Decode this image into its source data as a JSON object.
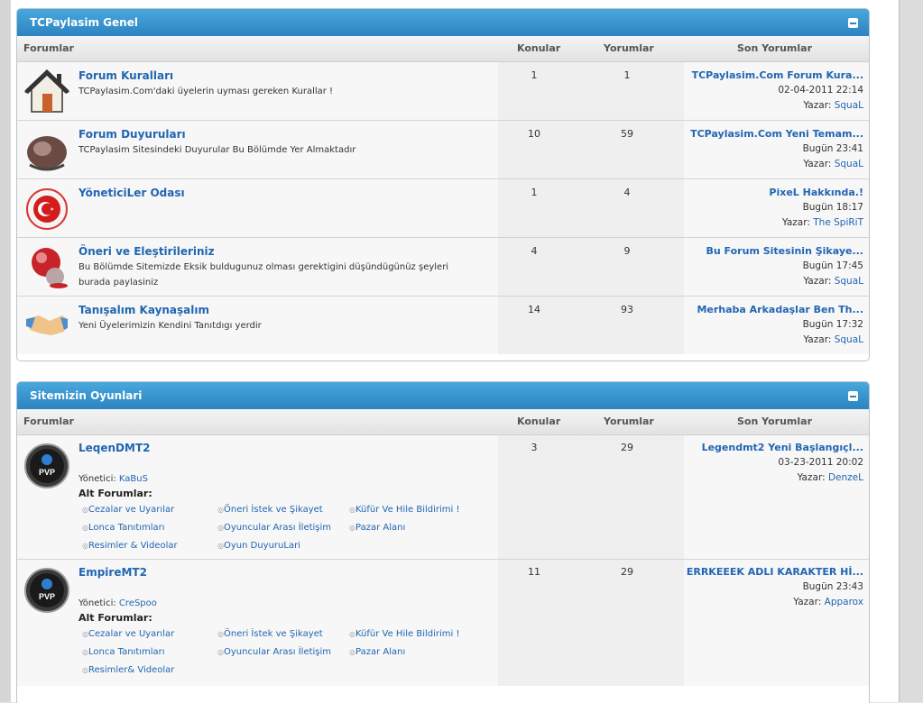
{
  "categories": [
    {
      "title": "TCPaylasim Genel",
      "columns": {
        "forums": "Forumlar",
        "topics": "Konular",
        "posts": "Yorumlar",
        "last": "Son Yorumlar"
      },
      "forums": [
        {
          "icon": "house-icon",
          "title": "Forum Kuralları",
          "desc": "TCPaylasim.Com'daki üyelerin uyması gereken Kurallar !",
          "topics": "1",
          "posts": "1",
          "last_title": "TCPaylasim.Com Forum Kura...",
          "last_date": "02-04-2011 22:14",
          "by_label": "Yazar:",
          "last_user": "SquaL"
        },
        {
          "icon": "megaphone-icon",
          "title": "Forum Duyuruları",
          "desc": "TCPaylasim Sitesindeki Duyurular Bu Bölümde Yer Almaktadır",
          "topics": "10",
          "posts": "59",
          "last_title": "TCPaylasim.Com Yeni Temam...",
          "last_date": "Bugün 23:41",
          "by_label": "Yazar:",
          "last_user": "SquaL"
        },
        {
          "icon": "turkish-flag-icon",
          "title": "YöneticiLer Odası",
          "desc": "",
          "topics": "1",
          "posts": "4",
          "last_title": "PixeL Hakkında.!",
          "last_date": "Bugün 18:17",
          "by_label": "Yazar:",
          "last_user": "The SpiRiT"
        },
        {
          "icon": "speech-bubble-icon",
          "title": "Öneri ve Eleştirileriniz",
          "desc": "Bu Bölümde Sitemizde Eksik buldugunuz olması gerektigini düşündügünüz şeyleri burada paylasiniz",
          "topics": "4",
          "posts": "9",
          "last_title": "Bu Forum Sitesinin Şikaye...",
          "last_date": "Bugün 17:45",
          "by_label": "Yazar:",
          "last_user": "SquaL"
        },
        {
          "icon": "handshake-icon",
          "title": "Tanışalım Kaynaşalım",
          "desc": "Yeni Üyelerimizin Kendini Tanıtdıgı yerdir",
          "topics": "14",
          "posts": "93",
          "last_title": "Merhaba Arkadaşlar Ben Th...",
          "last_date": "Bugün 17:32",
          "by_label": "Yazar:",
          "last_user": "SquaL"
        }
      ]
    },
    {
      "title": "Sitemizin Oyunlari",
      "columns": {
        "forums": "Forumlar",
        "topics": "Konular",
        "posts": "Yorumlar",
        "last": "Son Yorumlar"
      },
      "forums": [
        {
          "icon": "pvp-badge-icon",
          "badge": "PVP",
          "title": "LeqenDMT2",
          "mod_label": "Yönetici:",
          "mod_user": "KaBuS",
          "sub_label": "Alt Forumlar:",
          "subforums": [
            "Cezalar ve Uyarılar",
            "Öneri İstek ve Şikayet",
            "Küfür Ve Hile Bildirimi !",
            "Lonca Tanıtımları",
            "Oyuncular Arası İletişim",
            "Pazar Alanı",
            "Resimler & Videolar",
            "Oyun DuyuruLari"
          ],
          "topics": "3",
          "posts": "29",
          "last_title": "Legendmt2 Yeni Başlangıçl...",
          "last_date": "03-23-2011 20:02",
          "by_label": "Yazar:",
          "last_user": "DenzeL"
        },
        {
          "icon": "pvp-badge-icon",
          "badge": "PVP",
          "title": "EmpireMT2",
          "mod_label": "Yönetici:",
          "mod_user": "CreSpoo",
          "sub_label": "Alt Forumlar:",
          "subforums": [
            "Cezalar ve Uyarılar",
            "Öneri İstek ve Şikayet",
            "Küfür Ve Hile Bildirimi !",
            "Lonca Tanıtımları",
            "Oyuncular Arası İletişim",
            "Pazar Alanı",
            "Resimler& Videolar"
          ],
          "topics": "11",
          "posts": "29",
          "last_title": "ERRKEEEK ADLI KARAKTER Hİ...",
          "last_date": "Bugün 23:43",
          "by_label": "Yazar:",
          "last_user": "Apparox"
        }
      ]
    }
  ]
}
